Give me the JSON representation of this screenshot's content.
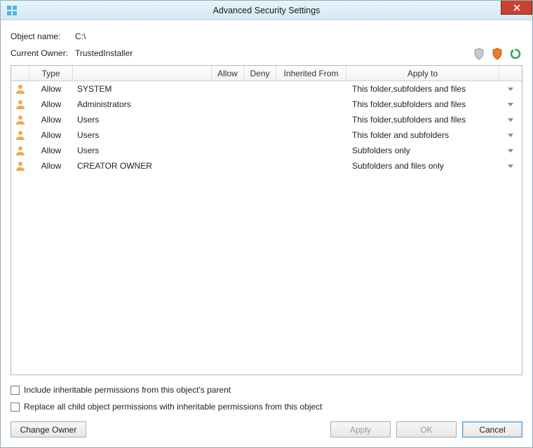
{
  "window": {
    "title": "Advanced Security Settings"
  },
  "object": {
    "label": "Object name:",
    "value": "C:\\"
  },
  "owner": {
    "label": "Current Owner:",
    "value": "TrustedInstaller"
  },
  "columns": {
    "type": "Type",
    "allow": "Allow",
    "deny": "Deny",
    "inherited": "Inherited From",
    "apply": "Apply to"
  },
  "rows": [
    {
      "type": "Allow",
      "principal": "SYSTEM",
      "inherited": "",
      "apply": "This folder,subfolders and files"
    },
    {
      "type": "Allow",
      "principal": "Administrators",
      "inherited": "",
      "apply": "This folder,subfolders and files"
    },
    {
      "type": "Allow",
      "principal": "Users",
      "inherited": "",
      "apply": "This folder,subfolders and files"
    },
    {
      "type": "Allow",
      "principal": "Users",
      "inherited": "",
      "apply": "This folder and subfolders"
    },
    {
      "type": "Allow",
      "principal": "Users",
      "inherited": "",
      "apply": "Subfolders only"
    },
    {
      "type": "Allow",
      "principal": "CREATOR OWNER",
      "inherited": "",
      "apply": "Subfolders and files only"
    }
  ],
  "checkboxes": {
    "inheritable": "Include inheritable permissions from this object's parent",
    "replace": "Replace all child object permissions with inheritable permissions from this object"
  },
  "buttons": {
    "change_owner": "Change Owner",
    "apply": "Apply",
    "ok": "OK",
    "cancel": "Cancel"
  }
}
